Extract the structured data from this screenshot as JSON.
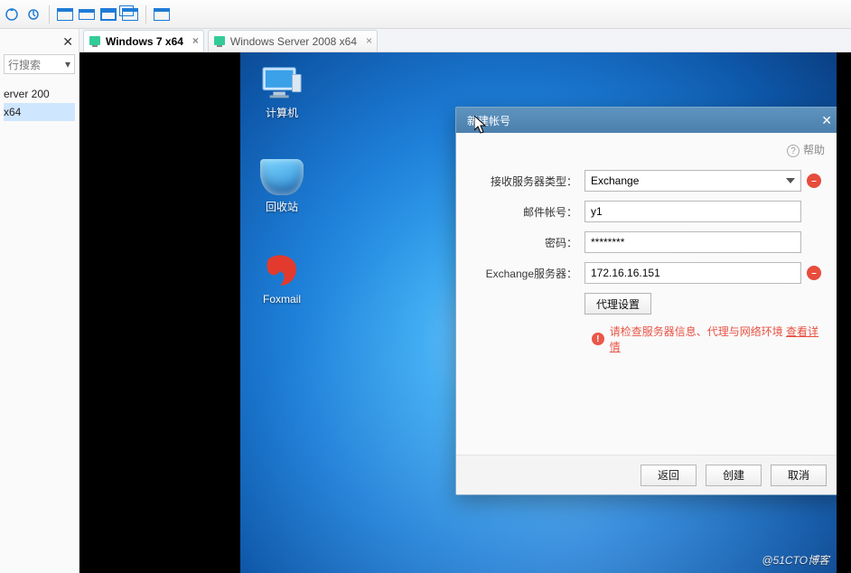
{
  "sidebar": {
    "search_placeholder": "行搜索",
    "items": [
      "erver 200",
      "x64"
    ],
    "selected_index": 1
  },
  "tabs": [
    {
      "label": "Windows 7 x64",
      "active": true
    },
    {
      "label": "Windows Server 2008 x64",
      "active": false
    }
  ],
  "desktop": {
    "icons": {
      "computer": "计算机",
      "recycle": "回收站",
      "foxmail": "Foxmail"
    }
  },
  "foxmail": {
    "title": "新建帐号",
    "help": "帮助",
    "labels": {
      "serverType": "接收服务器类型：",
      "account": "邮件帐号：",
      "password": "密码：",
      "exchange": "Exchange服务器：",
      "proxy": "代理设置"
    },
    "values": {
      "serverType": "Exchange",
      "account": "y1",
      "password": "********",
      "exchange": "172.16.16.151"
    },
    "error": {
      "msg": "请检查服务器信息、代理与网络环境 ",
      "link": "查看详情"
    },
    "buttons": {
      "back": "返回",
      "create": "创建",
      "cancel": "取消"
    }
  },
  "watermark": "@51CTO博客"
}
